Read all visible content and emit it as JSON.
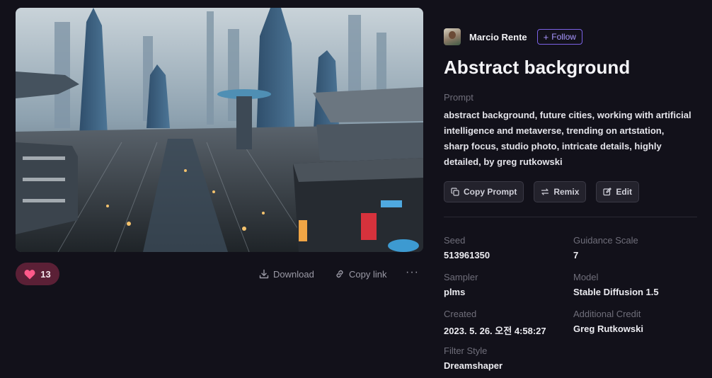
{
  "image": {
    "alt": "Abstract background"
  },
  "likes": {
    "count": "13",
    "icon": "heart-icon",
    "color": "#ff5a8a"
  },
  "toolbar": {
    "download_label": "Download",
    "copy_link_label": "Copy link",
    "more_label": "···"
  },
  "author": {
    "name": "Marcio Rente",
    "follow_label": "Follow",
    "follow_icon": "+"
  },
  "title": "Abstract background",
  "prompt": {
    "label": "Prompt",
    "text": "abstract background, future cities, working with artificial intelligence and metaverse, trending on artstation, sharp focus, studio photo, intricate details, highly detailed, by greg rutkowski"
  },
  "actions": {
    "copy_prompt_label": "Copy Prompt",
    "remix_label": "Remix",
    "edit_label": "Edit"
  },
  "meta": {
    "seed": {
      "label": "Seed",
      "value": "513961350"
    },
    "guidance": {
      "label": "Guidance Scale",
      "value": "7"
    },
    "sampler": {
      "label": "Sampler",
      "value": "plms"
    },
    "model": {
      "label": "Model",
      "value": "Stable Diffusion 1.5"
    },
    "created": {
      "label": "Created",
      "value": "2023. 5. 26. 오전 4:58:27"
    },
    "credit": {
      "label": "Additional Credit",
      "value": "Greg Rutkowski"
    },
    "filter": {
      "label": "Filter Style",
      "value": "Dreamshaper"
    }
  },
  "colors": {
    "background": "#12111a",
    "accent": "#7b62e6",
    "like_bg": "#5b2036"
  }
}
